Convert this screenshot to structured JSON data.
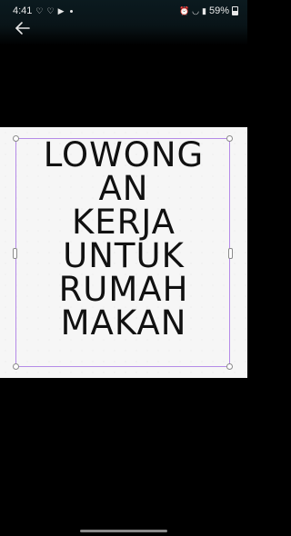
{
  "status_bar": {
    "time": "4:41",
    "battery_percent": "59%",
    "notification_icons": [
      "heart-icon",
      "heart-icon",
      "youtube-icon"
    ],
    "system_icons": [
      "alarm-icon",
      "wifi-icon",
      "wifi-calling-icon",
      "signal-icon",
      "battery-icon"
    ]
  },
  "header": {
    "back_icon": "arrow-left-icon"
  },
  "poster": {
    "lines": [
      "LOWONG",
      "AN",
      "KERJA",
      "UNTUK",
      "RUMAH",
      "MAKAN"
    ],
    "text_color": "#111111",
    "background_color": "#f6f6f6",
    "frame_color": "#b58be8"
  },
  "colors": {
    "screen_background": "#000000",
    "status_bar_background": "#0b1a1f"
  }
}
